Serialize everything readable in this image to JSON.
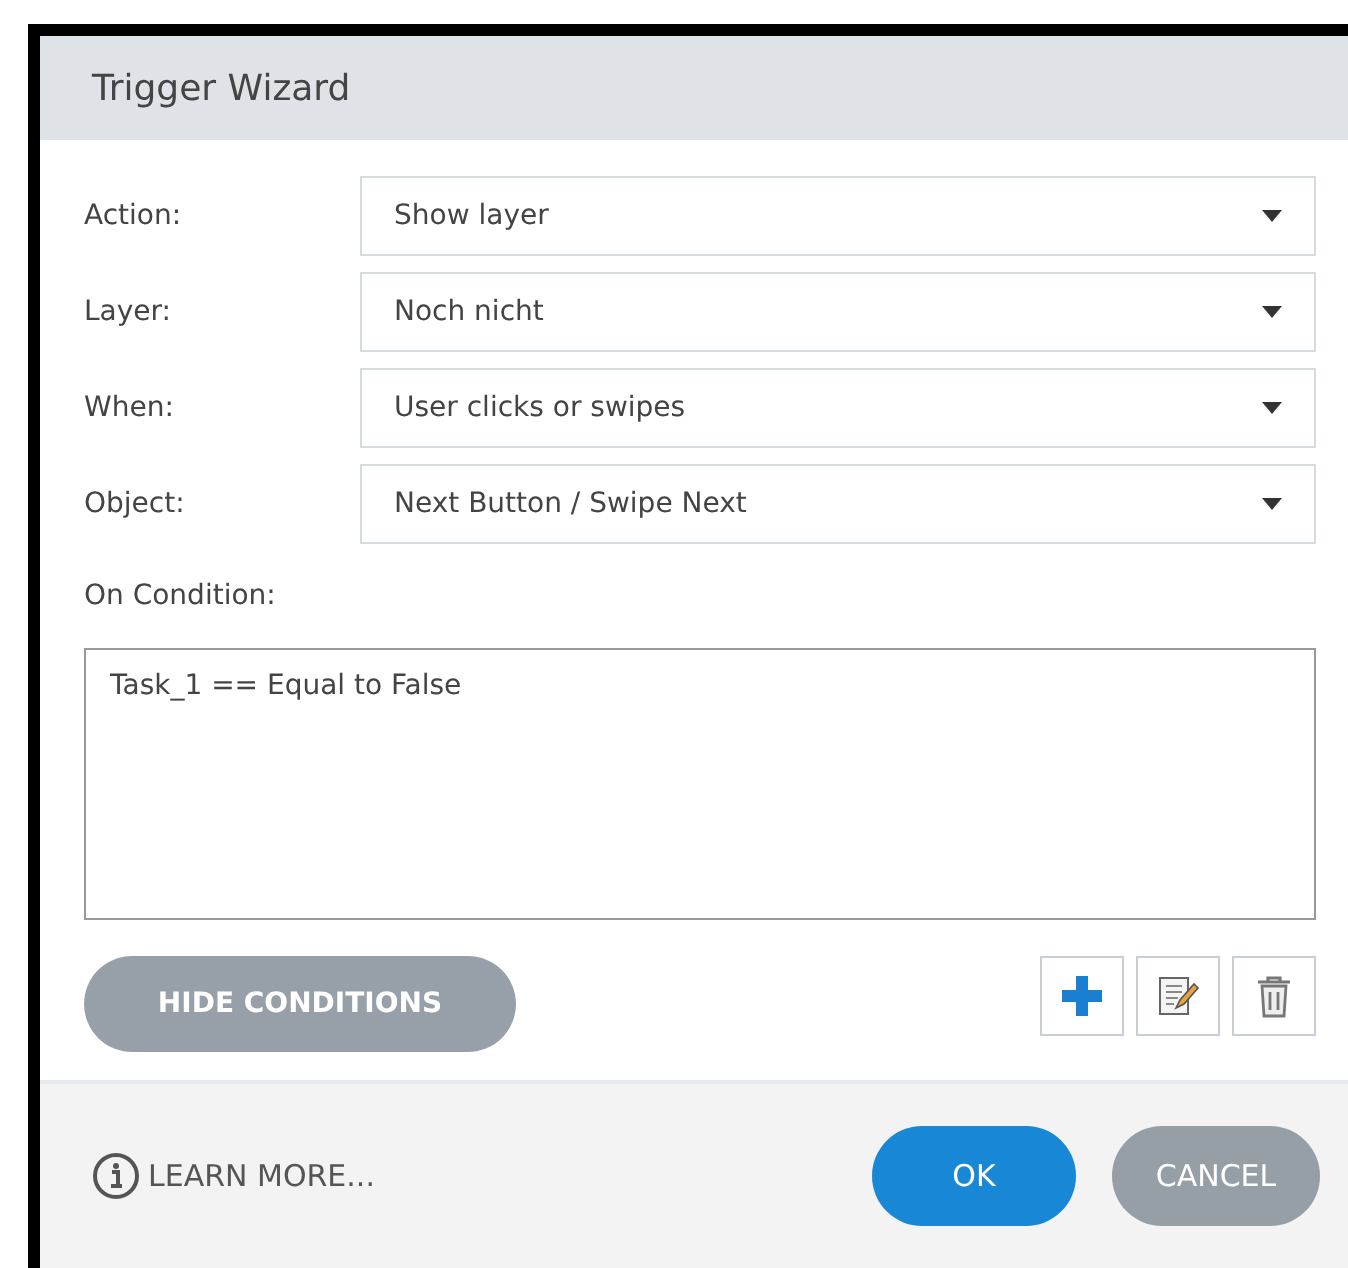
{
  "window": {
    "title": "Trigger Wizard"
  },
  "fields": [
    {
      "label": "Action:",
      "value": "Show layer"
    },
    {
      "label": "Layer:",
      "value": "Noch nicht"
    },
    {
      "label": "When:",
      "value": "User clicks or swipes"
    },
    {
      "label": "Object:",
      "value": "Next Button / Swipe Next"
    }
  ],
  "conditions": {
    "label": "On Condition:",
    "items": [
      "Task_1 == Equal to False"
    ],
    "toggle_button": "HIDE CONDITIONS"
  },
  "footer": {
    "learn_more": "LEARN MORE...",
    "ok": "OK",
    "cancel": "CANCEL"
  }
}
